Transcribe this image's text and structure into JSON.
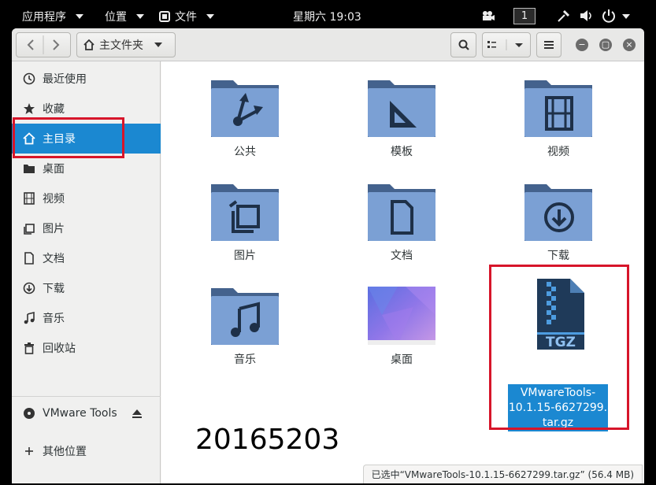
{
  "topbar": {
    "apps_menu": "应用程序",
    "places_menu": "位置",
    "files_menu": "文件",
    "clock": "星期六 19:03",
    "workspace": "1"
  },
  "window": {
    "location_label": "主文件夹"
  },
  "sidebar": {
    "items": [
      {
        "label": "最近使用",
        "icon": "clock-icon"
      },
      {
        "label": "收藏",
        "icon": "star-icon"
      },
      {
        "label": "主目录",
        "icon": "home-icon"
      },
      {
        "label": "桌面",
        "icon": "folder-icon"
      },
      {
        "label": "视频",
        "icon": "film-icon"
      },
      {
        "label": "图片",
        "icon": "picture-icon"
      },
      {
        "label": "文档",
        "icon": "document-icon"
      },
      {
        "label": "下载",
        "icon": "download-icon"
      },
      {
        "label": "音乐",
        "icon": "music-icon"
      },
      {
        "label": "回收站",
        "icon": "trash-icon"
      }
    ],
    "device": {
      "label": "VMware Tools",
      "icon": "disc-icon"
    },
    "other": {
      "label": "其他位置",
      "icon": "plus-icon"
    }
  },
  "files": [
    {
      "name": "公共",
      "icon": "share-folder-icon"
    },
    {
      "name": "模板",
      "icon": "template-folder-icon"
    },
    {
      "name": "视频",
      "icon": "video-folder-icon"
    },
    {
      "name": "图片",
      "icon": "pictures-folder-icon"
    },
    {
      "name": "文档",
      "icon": "documents-folder-icon"
    },
    {
      "name": "下载",
      "icon": "downloads-folder-icon"
    },
    {
      "name": "音乐",
      "icon": "music-folder-icon"
    },
    {
      "name": "桌面",
      "icon": "desktop-folder-icon"
    }
  ],
  "selected_file": {
    "name_line1": "VMwareTools-",
    "name_line2": "10.1.15-6627299.",
    "name_line3": "tar.gz",
    "badge": "TGZ"
  },
  "overlay_text": "20165203",
  "status_bar": "已选中“VMwareTools-10.1.15-6627299.tar.gz” (56.4 MB)",
  "colors": {
    "selection": "#1b88d1",
    "folder": "#6f95c8",
    "folder_tab": "#44628d",
    "highlight_box": "#d7152a"
  }
}
